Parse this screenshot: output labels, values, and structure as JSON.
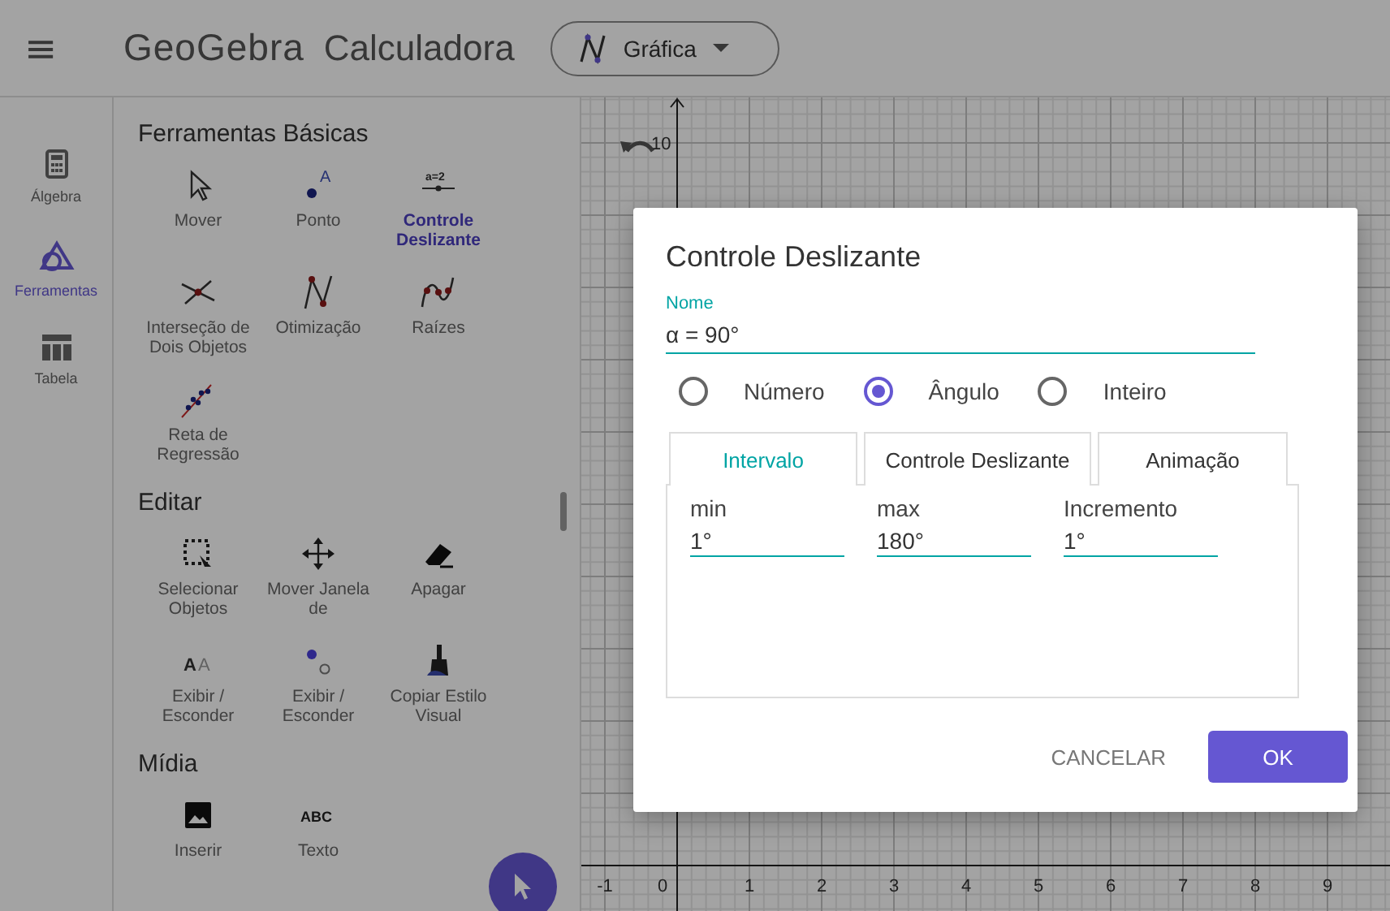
{
  "header": {
    "menu": "≡",
    "logo": "GeoGebra",
    "app_name": "Calculadora",
    "view_picker": "Gráfica"
  },
  "rail": [
    {
      "label": "Álgebra",
      "selected": false
    },
    {
      "label": "Ferramentas",
      "selected": true
    },
    {
      "label": "Tabela",
      "selected": false
    }
  ],
  "tool_sections": [
    {
      "title": "Ferramentas Básicas",
      "tools": [
        {
          "label": "Mover",
          "selected": false
        },
        {
          "label": "Ponto",
          "selected": false,
          "icon_text": [
            "A"
          ]
        },
        {
          "label": "Controle Deslizante",
          "selected": true,
          "icon_text": [
            "a=2"
          ]
        },
        {
          "label": "Interseção de Dois Objetos",
          "selected": false
        },
        {
          "label": "Otimização",
          "selected": false
        },
        {
          "label": "Raízes",
          "selected": false
        },
        {
          "label": "Reta de Regressão",
          "selected": false
        }
      ]
    },
    {
      "title": "Editar",
      "tools": [
        {
          "label": "Selecionar Objetos",
          "selected": false
        },
        {
          "label": "Mover Janela de",
          "selected": false
        },
        {
          "label": "Apagar",
          "selected": false
        },
        {
          "label": "Exibir / Esconder",
          "selected": false,
          "icon_text": [
            "A",
            "A"
          ]
        },
        {
          "label": "Exibir / Esconder",
          "selected": false
        },
        {
          "label": "Copiar Estilo Visual",
          "selected": false
        }
      ]
    },
    {
      "title": "Mídia",
      "tools": [
        {
          "label": "Inserir",
          "selected": false
        },
        {
          "label": "Texto",
          "selected": false,
          "icon_text": [
            "ABC"
          ]
        }
      ]
    }
  ],
  "graph": {
    "y_label": "10",
    "x_labels": [
      "-1",
      "0",
      "1",
      "2",
      "3",
      "4",
      "5",
      "6",
      "7",
      "8",
      "9"
    ]
  },
  "dialog": {
    "title": "Controle Deslizante",
    "name_field": {
      "label": "Nome",
      "value": "α = 90°"
    },
    "types": [
      {
        "label": "Número",
        "selected": false
      },
      {
        "label": "Ângulo",
        "selected": true
      },
      {
        "label": "Inteiro",
        "selected": false
      }
    ],
    "tabs": [
      {
        "label": "Intervalo",
        "selected": true
      },
      {
        "label": "Controle Deslizante",
        "selected": false
      },
      {
        "label": "Animação",
        "selected": false
      }
    ],
    "fields": [
      {
        "label": "min",
        "value": "1°"
      },
      {
        "label": "max",
        "value": "180°"
      },
      {
        "label": "Incremento",
        "value": "1°"
      }
    ],
    "buttons": [
      {
        "label": "CANCELAR",
        "kind": "text"
      },
      {
        "label": "OK",
        "kind": "primary"
      }
    ]
  }
}
